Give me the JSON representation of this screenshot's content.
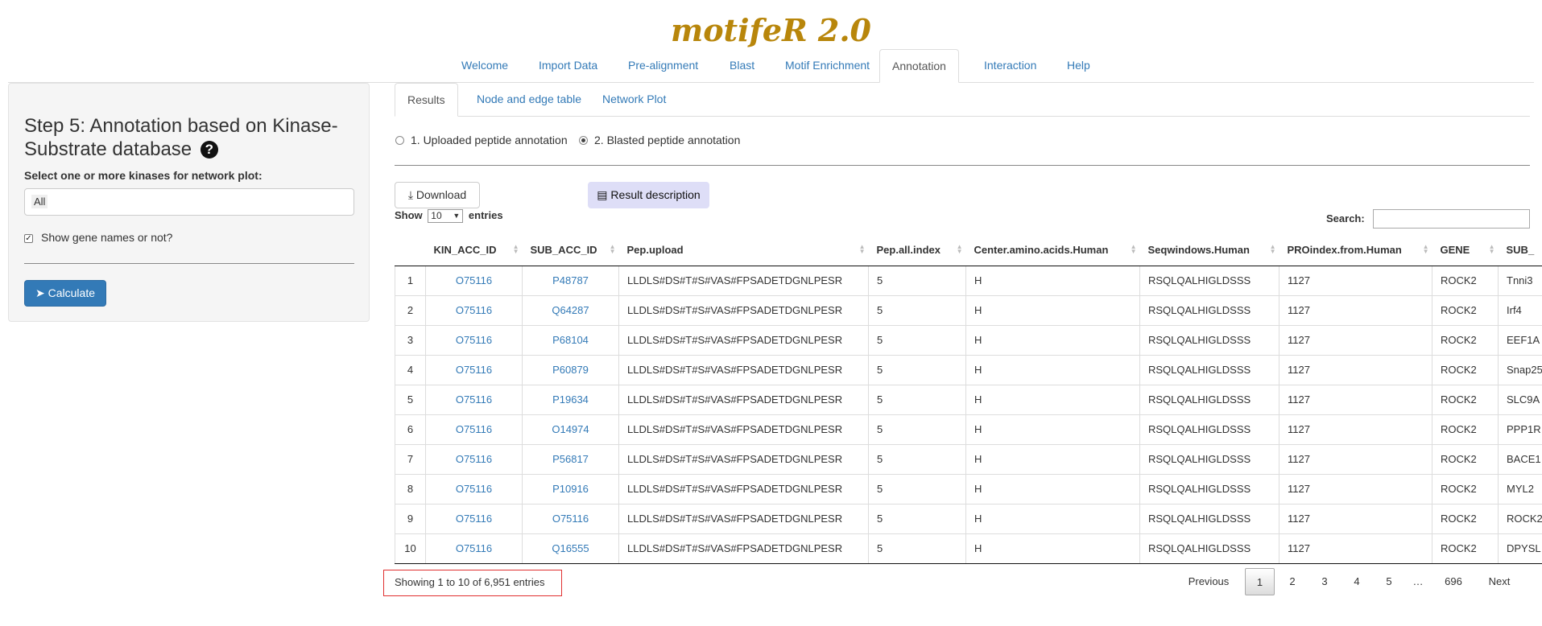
{
  "app": {
    "title": "motifeR 2.0"
  },
  "top_tabs": [
    "Welcome",
    "Import Data",
    "Pre-alignment",
    "Blast",
    "Motif Enrichment",
    "Annotation",
    "Interaction",
    "Help"
  ],
  "sidebar": {
    "heading": "Step 5: Annotation based on Kinase-Substrate database",
    "select_label": "Select one or more kinases for network plot:",
    "select_value": "All",
    "checkbox_label": "Show gene names or not?",
    "checkbox_checked": true,
    "calculate_label": "Calculate"
  },
  "inner_tabs": [
    "Results",
    "Node and edge table",
    "Network Plot"
  ],
  "radios": [
    {
      "label": "1. Uploaded peptide annotation",
      "checked": false
    },
    {
      "label": "2. Blasted peptide annotation",
      "checked": true
    }
  ],
  "buttons": {
    "download": "Download",
    "description": "Result description"
  },
  "table_controls": {
    "show": "Show",
    "length": "10",
    "entries": "entries",
    "search_label": "Search:"
  },
  "table": {
    "columns": [
      "",
      "KIN_ACC_ID",
      "SUB_ACC_ID",
      "Pep.upload",
      "Pep.all.index",
      "Center.amino.acids.Human",
      "Seqwindows.Human",
      "PROindex.from.Human",
      "GENE",
      "SUB_"
    ],
    "rows": [
      [
        "1",
        "O75116",
        "P48787",
        "LLDLS#DS#T#S#VAS#FPSADETDGNLPESR",
        "5",
        "H",
        "RSQLQALHIGLDSSS",
        "1127",
        "ROCK2",
        "Tnni3"
      ],
      [
        "2",
        "O75116",
        "Q64287",
        "LLDLS#DS#T#S#VAS#FPSADETDGNLPESR",
        "5",
        "H",
        "RSQLQALHIGLDSSS",
        "1127",
        "ROCK2",
        "Irf4"
      ],
      [
        "3",
        "O75116",
        "P68104",
        "LLDLS#DS#T#S#VAS#FPSADETDGNLPESR",
        "5",
        "H",
        "RSQLQALHIGLDSSS",
        "1127",
        "ROCK2",
        "EEF1A"
      ],
      [
        "4",
        "O75116",
        "P60879",
        "LLDLS#DS#T#S#VAS#FPSADETDGNLPESR",
        "5",
        "H",
        "RSQLQALHIGLDSSS",
        "1127",
        "ROCK2",
        "Snap25"
      ],
      [
        "5",
        "O75116",
        "P19634",
        "LLDLS#DS#T#S#VAS#FPSADETDGNLPESR",
        "5",
        "H",
        "RSQLQALHIGLDSSS",
        "1127",
        "ROCK2",
        "SLC9A"
      ],
      [
        "6",
        "O75116",
        "O14974",
        "LLDLS#DS#T#S#VAS#FPSADETDGNLPESR",
        "5",
        "H",
        "RSQLQALHIGLDSSS",
        "1127",
        "ROCK2",
        "PPP1R"
      ],
      [
        "7",
        "O75116",
        "P56817",
        "LLDLS#DS#T#S#VAS#FPSADETDGNLPESR",
        "5",
        "H",
        "RSQLQALHIGLDSSS",
        "1127",
        "ROCK2",
        "BACE1"
      ],
      [
        "8",
        "O75116",
        "P10916",
        "LLDLS#DS#T#S#VAS#FPSADETDGNLPESR",
        "5",
        "H",
        "RSQLQALHIGLDSSS",
        "1127",
        "ROCK2",
        "MYL2"
      ],
      [
        "9",
        "O75116",
        "O75116",
        "LLDLS#DS#T#S#VAS#FPSADETDGNLPESR",
        "5",
        "H",
        "RSQLQALHIGLDSSS",
        "1127",
        "ROCK2",
        "ROCK2"
      ],
      [
        "10",
        "O75116",
        "Q16555",
        "LLDLS#DS#T#S#VAS#FPSADETDGNLPESR",
        "5",
        "H",
        "RSQLQALHIGLDSSS",
        "1127",
        "ROCK2",
        "DPYSL"
      ]
    ]
  },
  "info_text": "Showing 1 to 10 of 6,951 entries",
  "pagination": [
    "Previous",
    "1",
    "2",
    "3",
    "4",
    "5",
    "…",
    "696",
    "Next"
  ],
  "pagination_active": "1"
}
